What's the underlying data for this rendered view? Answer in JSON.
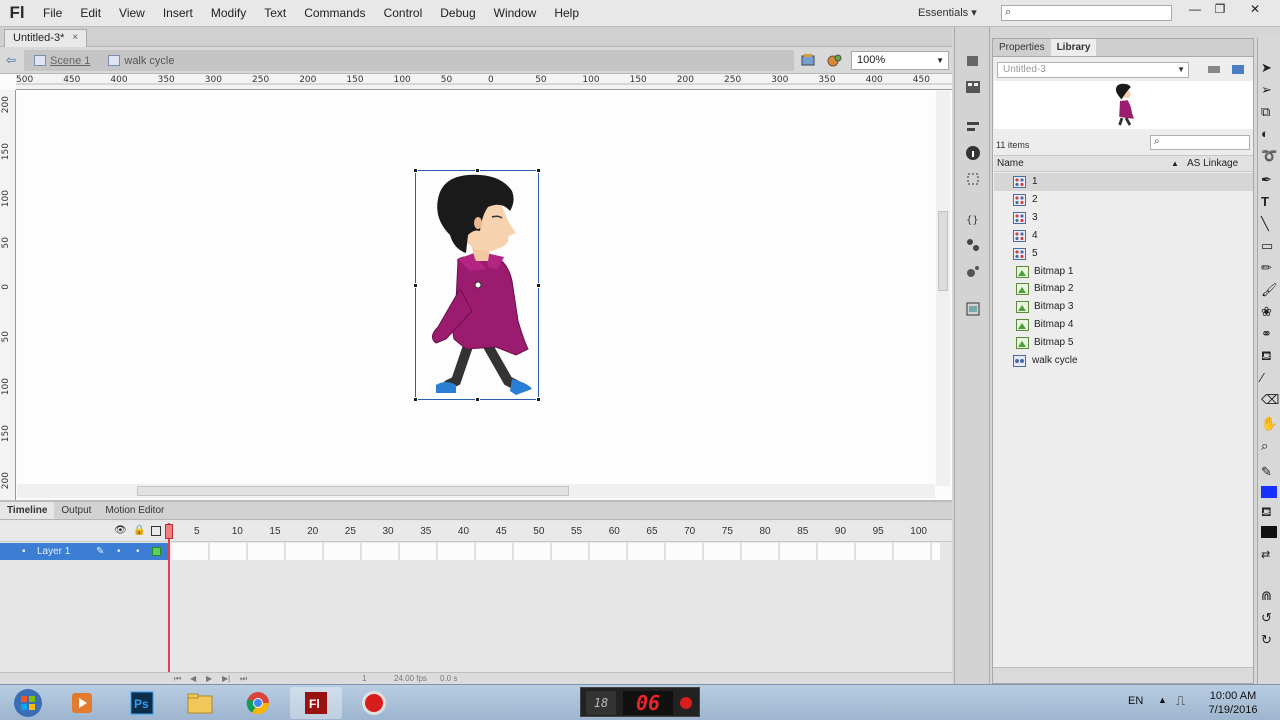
{
  "app": {
    "logo": "Fl",
    "menu": [
      "File",
      "Edit",
      "View",
      "Insert",
      "Modify",
      "Text",
      "Commands",
      "Control",
      "Debug",
      "Window",
      "Help"
    ],
    "workspace": "Essentials"
  },
  "document": {
    "tab_title": "Untitled-3*",
    "close": "×"
  },
  "editbar": {
    "scene_label": "Scene 1",
    "symbol_label": "walk cycle",
    "zoom": "100%"
  },
  "rulers": {
    "horizontal": [
      "500",
      "450",
      "400",
      "350",
      "300",
      "250",
      "200",
      "150",
      "100",
      "50",
      "0",
      "50",
      "100",
      "150",
      "200",
      "250",
      "300",
      "350",
      "400",
      "450"
    ],
    "vertical": [
      "200",
      "150",
      "100",
      "50",
      "0",
      "50",
      "100",
      "150",
      "200"
    ]
  },
  "timeline": {
    "tabs": [
      "Timeline",
      "Output",
      "Motion Editor"
    ],
    "frame_numbers": [
      "5",
      "10",
      "15",
      "20",
      "25",
      "30",
      "35",
      "40",
      "45",
      "50",
      "55",
      "60",
      "65",
      "70",
      "75",
      "80",
      "85",
      "90",
      "95",
      "100"
    ],
    "layer_name": "Layer 1",
    "current_frame": "1",
    "fps": "24.00 fps",
    "elapsed": "0.0 s"
  },
  "library": {
    "tabs": [
      "Properties",
      "Library"
    ],
    "document": "Untitled-3",
    "item_count": "11 items",
    "col_name": "Name",
    "col_linkage": "AS Linkage",
    "items": [
      {
        "label": "1",
        "type": "graphic-symbol"
      },
      {
        "label": "2",
        "type": "graphic-symbol"
      },
      {
        "label": "3",
        "type": "graphic-symbol"
      },
      {
        "label": "4",
        "type": "graphic-symbol"
      },
      {
        "label": "5",
        "type": "graphic-symbol"
      },
      {
        "label": "Bitmap 1",
        "type": "bitmap"
      },
      {
        "label": "Bitmap 2",
        "type": "bitmap"
      },
      {
        "label": "Bitmap 3",
        "type": "bitmap"
      },
      {
        "label": "Bitmap 4",
        "type": "bitmap"
      },
      {
        "label": "Bitmap 5",
        "type": "bitmap"
      },
      {
        "label": "walk cycle",
        "type": "movieclip"
      }
    ]
  },
  "taskbar": {
    "lang": "EN",
    "time": "10:00 AM",
    "date": "7/19/2016",
    "rec_small": "18",
    "rec_big": "06"
  },
  "colors": {
    "selection_blue": "#3b7ed4",
    "playhead": "#e0404a",
    "jacket": "#9b1b6e",
    "shoes": "#2a7fd4"
  }
}
